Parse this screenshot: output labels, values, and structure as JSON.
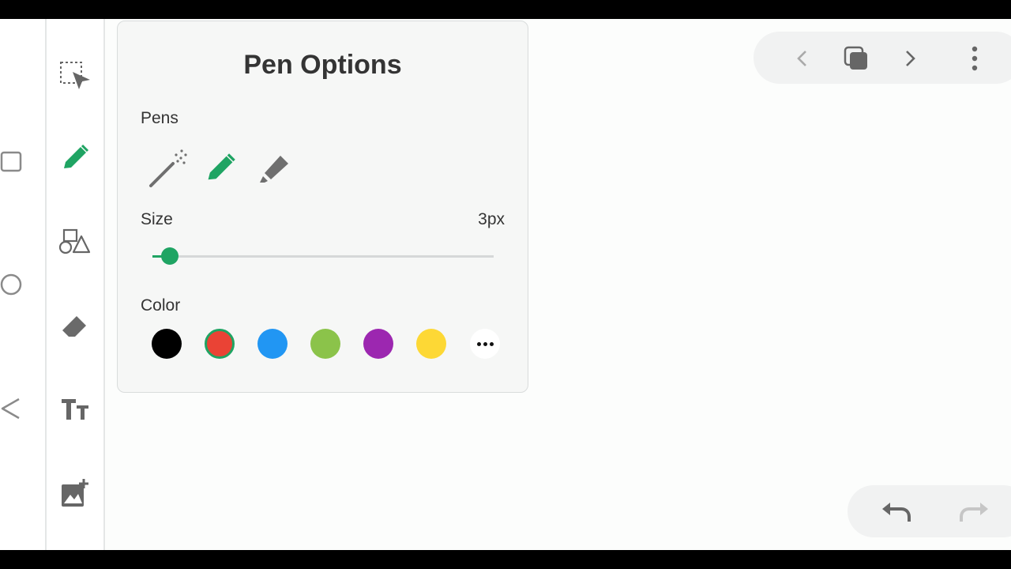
{
  "panel": {
    "title": "Pen Options",
    "pens_label": "Pens",
    "size_label": "Size",
    "size_value": "3px",
    "size_fraction": 0.05,
    "color_label": "Color",
    "selected_pen": "pen",
    "selected_color": "red"
  },
  "pens": [
    {
      "name": "magic-pen-icon",
      "color": "#6f6f6f"
    },
    {
      "name": "pen-icon",
      "color": "#1fa463"
    },
    {
      "name": "highlighter-icon",
      "color": "#6f6f6f"
    }
  ],
  "colors": [
    {
      "name": "black",
      "hex": "#000000"
    },
    {
      "name": "red",
      "hex": "#ea4335"
    },
    {
      "name": "blue",
      "hex": "#2196f3"
    },
    {
      "name": "green",
      "hex": "#8bc34a"
    },
    {
      "name": "purple",
      "hex": "#9c27b0"
    },
    {
      "name": "yellow",
      "hex": "#fdd835"
    }
  ],
  "accent": "#1fa463",
  "tools": [
    "select-icon",
    "pen-icon",
    "shapes-icon",
    "eraser-icon",
    "text-icon",
    "add-image-icon"
  ],
  "active_tool": "pen-icon",
  "topbar": [
    "back-icon",
    "overview-icon",
    "forward-icon",
    "more-vert-icon"
  ],
  "undobar": [
    "undo-icon",
    "redo-icon"
  ]
}
